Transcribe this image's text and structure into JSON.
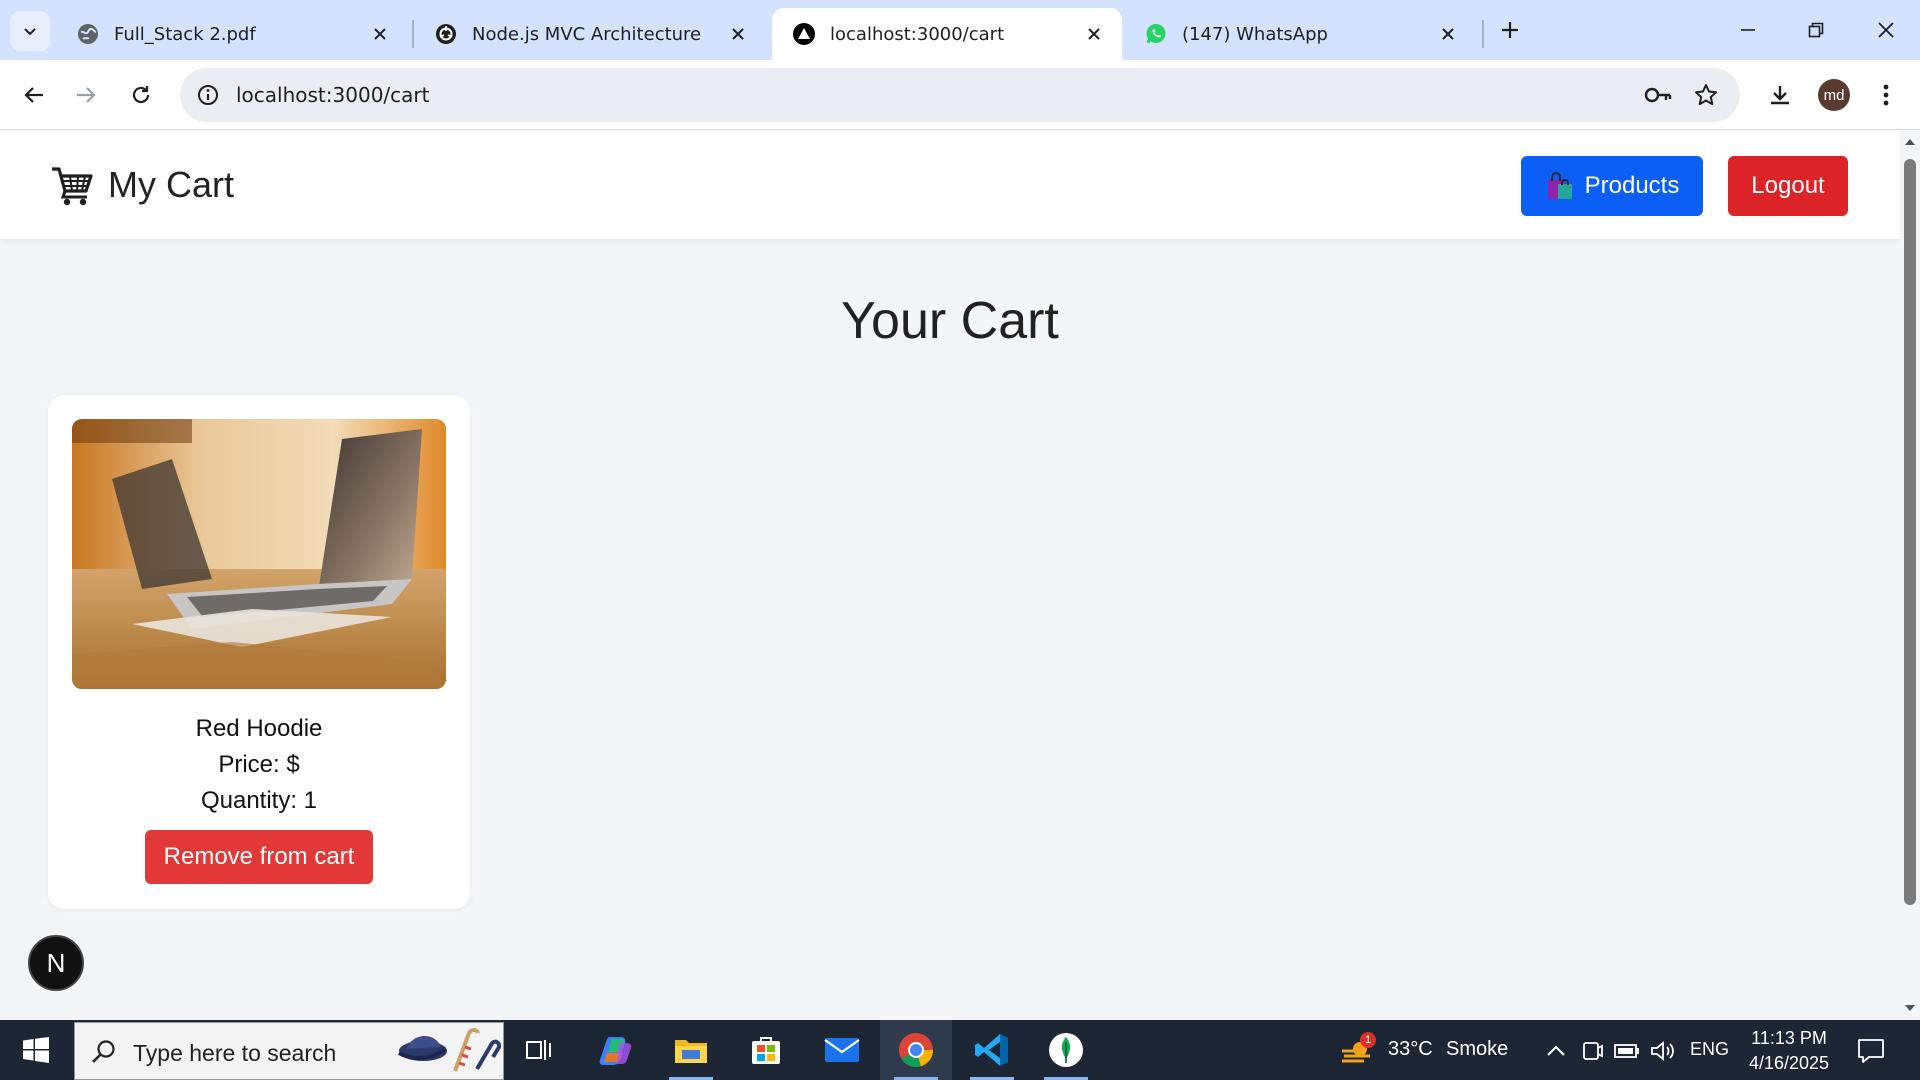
{
  "browser": {
    "tabs": [
      {
        "title": "Full_Stack 2.pdf",
        "icon": "globe-icon",
        "active": false
      },
      {
        "title": "Node.js MVC Architecture",
        "icon": "chatgpt-icon",
        "active": false
      },
      {
        "title": "localhost:3000/cart",
        "icon": "vercel-triangle-icon",
        "active": true
      },
      {
        "title": "(147) WhatsApp",
        "icon": "whatsapp-icon",
        "active": false
      }
    ],
    "address": "localhost:3000/cart",
    "profile_initials": "md"
  },
  "navbar": {
    "brand_title": "My Cart",
    "brand_icon": "shopping-cart-icon",
    "products_label": "Products",
    "logout_label": "Logout"
  },
  "page": {
    "title": "Your Cart"
  },
  "cart_items": [
    {
      "name": "Red Hoodie",
      "price_text": "Price: $",
      "quantity_text": "Quantity: 1",
      "remove_label": "Remove from cart",
      "image": "laptop-on-desk-photo"
    }
  ],
  "dev_overlay": {
    "badge_letter": "N"
  },
  "taskbar": {
    "search_placeholder": "Type here to search",
    "weather_badge": "1",
    "temperature": "33°C",
    "weather": "Smoke",
    "language": "ENG",
    "time": "11:13 PM",
    "date": "4/16/2025"
  },
  "colors": {
    "products_button": "#0b5ff6",
    "logout_button": "#dc2328",
    "remove_button": "#e23838",
    "tabstrip": "#d3e3fd"
  }
}
